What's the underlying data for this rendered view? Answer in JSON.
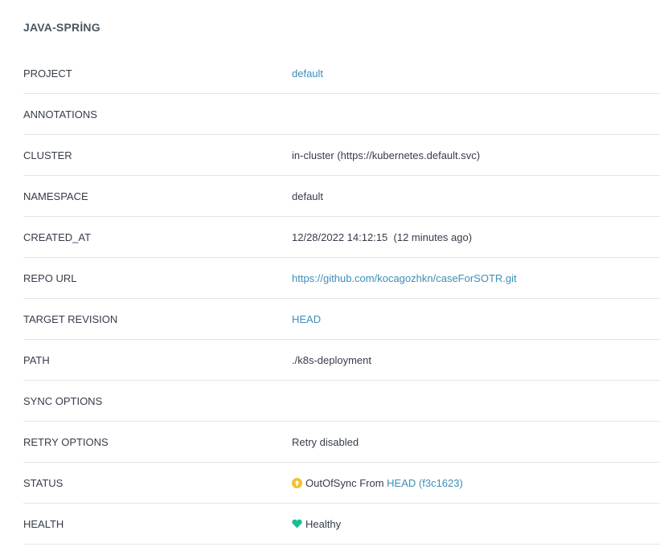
{
  "app": {
    "title": "JAVA-SPRİNG"
  },
  "colors": {
    "link": "#3d8eb9",
    "out_of_sync": "#f4c030",
    "healthy": "#18be94",
    "divider": "#dee6eb"
  },
  "fields": {
    "project": {
      "label": "PROJECT",
      "value": "default"
    },
    "annotations": {
      "label": "ANNOTATIONS",
      "value": ""
    },
    "cluster": {
      "label": "CLUSTER",
      "value": "in-cluster (https://kubernetes.default.svc)"
    },
    "namespace": {
      "label": "NAMESPACE",
      "value": "default"
    },
    "created_at": {
      "label": "CREATED_AT",
      "value": "12/28/2022 14:12:15",
      "relative": "(12 minutes ago)"
    },
    "repo_url": {
      "label": "REPO URL",
      "value": "https://github.com/kocagozhkn/caseForSOTR.git"
    },
    "target_revision": {
      "label": "TARGET REVISION",
      "value": "HEAD"
    },
    "path": {
      "label": "PATH",
      "value": "./k8s-deployment"
    },
    "sync_options": {
      "label": "SYNC OPTIONS",
      "value": ""
    },
    "retry_options": {
      "label": "RETRY OPTIONS",
      "value": "Retry disabled"
    },
    "status": {
      "label": "STATUS",
      "icon": "arrow-up-circle-icon",
      "text": "OutOfSync From",
      "revision": "HEAD",
      "commit": "(f3c1623)"
    },
    "health": {
      "label": "HEALTH",
      "icon": "heart-icon",
      "text": "Healthy"
    }
  }
}
